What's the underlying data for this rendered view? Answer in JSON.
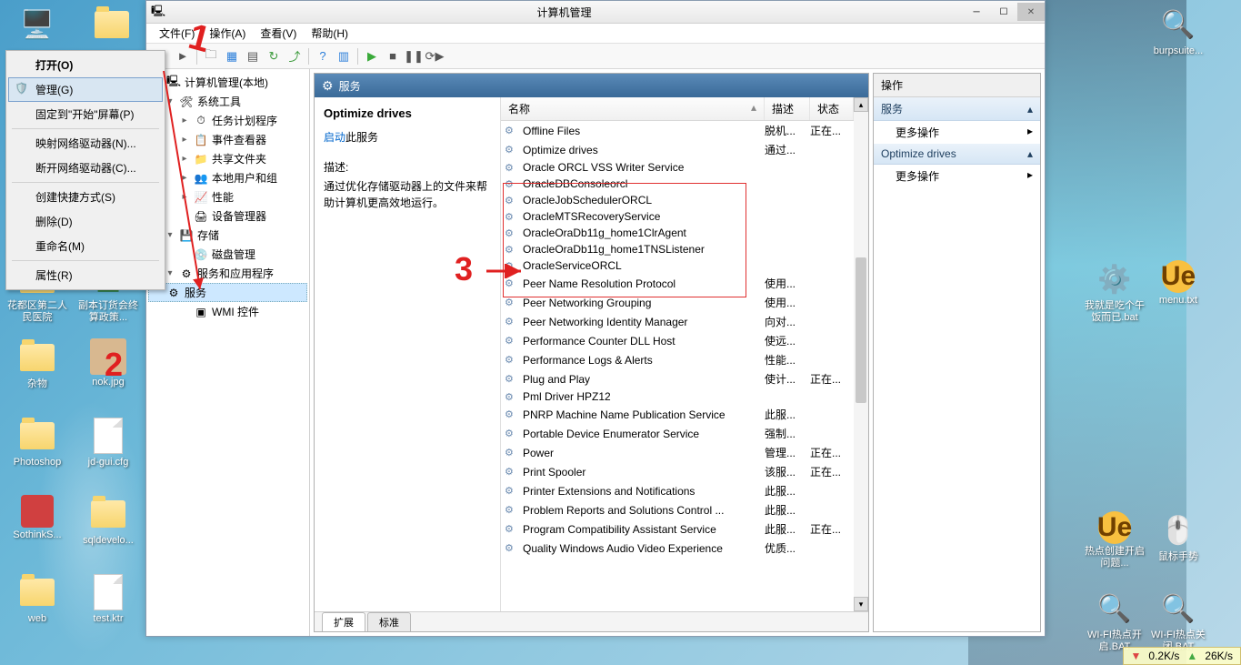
{
  "window": {
    "title": "计算机管理"
  },
  "menubar": {
    "file": "文件(F)",
    "action": "操作(A)",
    "view": "查看(V)",
    "help": "帮助(H)"
  },
  "context_menu": {
    "open": "打开(O)",
    "manage": "管理(G)",
    "pin": "固定到\"开始\"屏幕(P)",
    "map_drive": "映射网络驱动器(N)...",
    "disconnect_drive": "断开网络驱动器(C)...",
    "shortcut": "创建快捷方式(S)",
    "delete": "删除(D)",
    "rename": "重命名(M)",
    "properties": "属性(R)"
  },
  "tree": {
    "root": "计算机管理(本地)",
    "system_tools": "系统工具",
    "task_scheduler": "任务计划程序",
    "event_viewer": "事件查看器",
    "shared_folders": "共享文件夹",
    "local_users": "本地用户和组",
    "performance": "性能",
    "device_mgr": "设备管理器",
    "storage": "存储",
    "disk_mgmt": "磁盘管理",
    "services_apps": "服务和应用程序",
    "services": "服务",
    "wmi": "WMI 控件"
  },
  "center": {
    "header": "服务",
    "detail_title": "Optimize drives",
    "start_link": "启动",
    "start_suffix": "此服务",
    "desc_label": "描述:",
    "desc_text": "通过优化存储驱动器上的文件来帮助计算机更高效地运行。",
    "col_name": "名称",
    "col_desc": "描述",
    "col_state": "状态",
    "tab_ext": "扩展",
    "tab_std": "标准"
  },
  "services": [
    {
      "name": "Offline Files",
      "desc": "脱机...",
      "state": "正在..."
    },
    {
      "name": "Optimize drives",
      "desc": "通过...",
      "state": ""
    },
    {
      "name": "Oracle ORCL VSS Writer Service",
      "desc": "",
      "state": ""
    },
    {
      "name": "OracleDBConsoleorcl",
      "desc": "",
      "state": ""
    },
    {
      "name": "OracleJobSchedulerORCL",
      "desc": "",
      "state": ""
    },
    {
      "name": "OracleMTSRecoveryService",
      "desc": "",
      "state": ""
    },
    {
      "name": "OracleOraDb11g_home1ClrAgent",
      "desc": "",
      "state": ""
    },
    {
      "name": "OracleOraDb11g_home1TNSListener",
      "desc": "",
      "state": ""
    },
    {
      "name": "OracleServiceORCL",
      "desc": "",
      "state": ""
    },
    {
      "name": "Peer Name Resolution Protocol",
      "desc": "使用...",
      "state": ""
    },
    {
      "name": "Peer Networking Grouping",
      "desc": "使用...",
      "state": ""
    },
    {
      "name": "Peer Networking Identity Manager",
      "desc": "向对...",
      "state": ""
    },
    {
      "name": "Performance Counter DLL Host",
      "desc": "使远...",
      "state": ""
    },
    {
      "name": "Performance Logs & Alerts",
      "desc": "性能...",
      "state": ""
    },
    {
      "name": "Plug and Play",
      "desc": "使计...",
      "state": "正在..."
    },
    {
      "name": "Pml Driver HPZ12",
      "desc": "",
      "state": ""
    },
    {
      "name": "PNRP Machine Name Publication Service",
      "desc": "此服...",
      "state": ""
    },
    {
      "name": "Portable Device Enumerator Service",
      "desc": "强制...",
      "state": ""
    },
    {
      "name": "Power",
      "desc": "管理...",
      "state": "正在..."
    },
    {
      "name": "Print Spooler",
      "desc": "该服...",
      "state": "正在..."
    },
    {
      "name": "Printer Extensions and Notifications",
      "desc": "此服...",
      "state": ""
    },
    {
      "name": "Problem Reports and Solutions Control ...",
      "desc": "此服...",
      "state": ""
    },
    {
      "name": "Program Compatibility Assistant Service",
      "desc": "此服...",
      "state": "正在..."
    },
    {
      "name": "Quality Windows Audio Video Experience",
      "desc": "优质...",
      "state": ""
    }
  ],
  "actions": {
    "title": "操作",
    "section1": "服务",
    "more_ops": "更多操作",
    "section2": "Optimize drives"
  },
  "desktop": {
    "icon1": "花都区第二人民医院",
    "icon2": "副本订货会终算政策...",
    "icon3": "杂物",
    "icon4": "nok.jpg",
    "icon5": "Photoshop",
    "icon6": "jd-gui.cfg",
    "icon7": "SothinkS...",
    "icon8": "sqldevelo...",
    "icon9": "web",
    "icon10": "test.ktr",
    "icon_r1": "burpsuite...",
    "icon_r2": "我就是吃个午饭而已.bat",
    "icon_r3": "menu.txt",
    "icon_r4": "热点创建开启问题...",
    "icon_r5": "鼠标手势",
    "icon_r6": "WI-FI热点开启.BAT",
    "icon_r7": "WI-FI热点关闭.BAT"
  },
  "taskbar": {
    "down": "0.2K/s",
    "up": "26K/s"
  },
  "annotations": {
    "a1": "1",
    "a2": "2",
    "a3": "3"
  }
}
